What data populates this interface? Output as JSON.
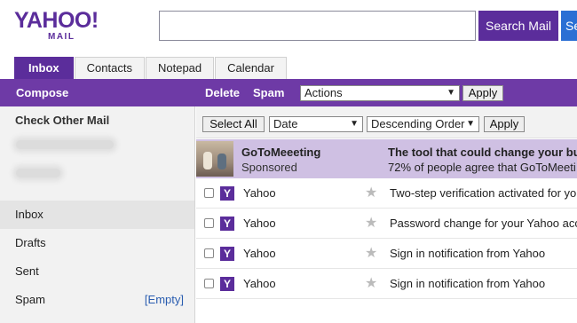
{
  "header": {
    "logo_main": "YAHOO!",
    "logo_sub": "MAIL",
    "search_placeholder": "",
    "search_button": "Search Mail",
    "web_button": "Search Web"
  },
  "tabs": [
    "Inbox",
    "Contacts",
    "Notepad",
    "Calendar"
  ],
  "toolbar": {
    "compose": "Compose",
    "delete": "Delete",
    "spam": "Spam",
    "actions_select": "Actions",
    "apply": "Apply"
  },
  "filter": {
    "select_all": "Select All",
    "sort_field": "Date",
    "sort_order": "Descending Order",
    "apply": "Apply"
  },
  "sidebar": {
    "check_other": "Check Other Mail",
    "folders": [
      {
        "label": "Inbox"
      },
      {
        "label": "Drafts"
      },
      {
        "label": "Sent"
      },
      {
        "label": "Spam",
        "action": "[Empty]"
      }
    ]
  },
  "sponsored": {
    "sender": "GoToMeeeting",
    "label": "Sponsored",
    "subject": "The tool that could change your bu",
    "snippet": "72% of people agree that GoToMeeti"
  },
  "messages": [
    {
      "sender": "Yahoo",
      "subject": "Two-step verification activated for yo"
    },
    {
      "sender": "Yahoo",
      "subject": "Password change for your Yahoo acc"
    },
    {
      "sender": "Yahoo",
      "subject": "Sign in notification from Yahoo"
    },
    {
      "sender": "Yahoo",
      "subject": "Sign in notification from Yahoo"
    }
  ],
  "colors": {
    "brand_purple": "#6e3aa6",
    "sponsored_bg": "#cfc0e3",
    "web_search_blue": "#2a6fd4"
  }
}
